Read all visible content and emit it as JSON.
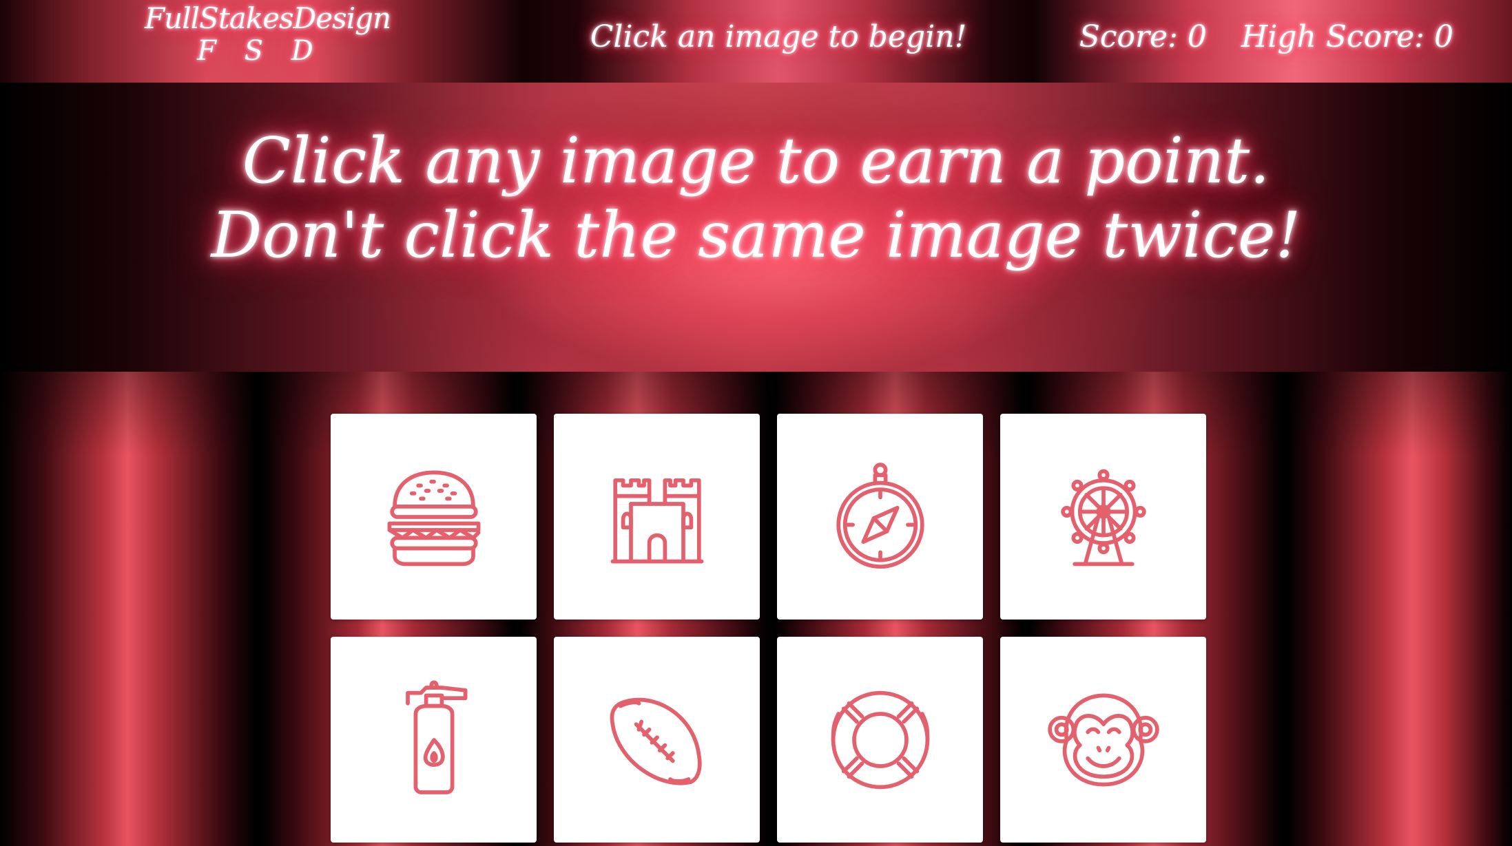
{
  "navbar": {
    "brand_name": "FullStakesDesign",
    "brand_initials": "F S D",
    "status_message": "Click an image to begin!",
    "score_label": "Score:",
    "score_value": "0",
    "high_score_label": "High Score:",
    "high_score_value": "0"
  },
  "hero": {
    "line1": "Click any image to earn a point.",
    "line2": "Don't click the same image twice!"
  },
  "cards": [
    {
      "icon": "burger-icon"
    },
    {
      "icon": "castle-icon"
    },
    {
      "icon": "compass-icon"
    },
    {
      "icon": "ferris-wheel-icon"
    },
    {
      "icon": "fire-extinguisher-icon"
    },
    {
      "icon": "football-icon"
    },
    {
      "icon": "life-ring-icon"
    },
    {
      "icon": "monkey-icon"
    }
  ],
  "colors": {
    "accent": "#e4606c",
    "glow": "#ff2d55",
    "card_bg": "#ffffff"
  }
}
